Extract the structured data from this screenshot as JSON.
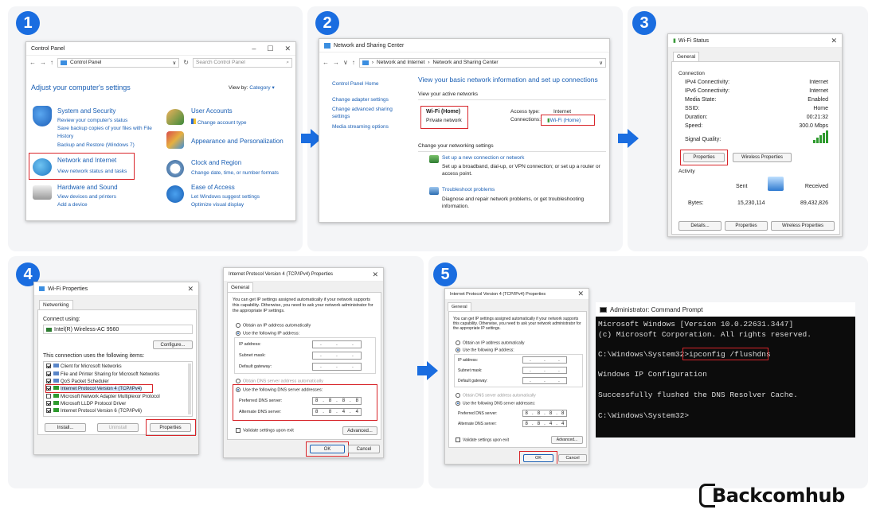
{
  "steps": [
    "1",
    "2",
    "3",
    "4",
    "5"
  ],
  "brand": "Backcomhub",
  "cp": {
    "title": "Control Panel",
    "address": "Control Panel",
    "search_placeholder": "Search Control Panel",
    "heading": "Adjust your computer's settings",
    "view_by_label": "View by:",
    "view_by_value": "Category",
    "categories": [
      {
        "title": "System and Security",
        "links": [
          "Review your computer's status",
          "Save backup copies of your files with File",
          "History",
          "Backup and Restore (Windows 7)"
        ]
      },
      {
        "title": "Network and Internet",
        "links": [
          "View network status and tasks"
        ]
      },
      {
        "title": "Hardware and Sound",
        "links": [
          "View devices and printers",
          "Add a device"
        ]
      },
      {
        "title": "User Accounts",
        "links": [
          "Change account type"
        ]
      },
      {
        "title": "Appearance and Personalization",
        "links": []
      },
      {
        "title": "Clock and Region",
        "links": [
          "Change date, time, or number formats"
        ]
      },
      {
        "title": "Ease of Access",
        "links": [
          "Let Windows suggest settings",
          "Optimize visual display"
        ]
      }
    ]
  },
  "nsc": {
    "title": "Network and Sharing Center",
    "crumb1": "Network and Internet",
    "crumb2": "Network and Sharing Center",
    "side": [
      "Control Panel Home",
      "Change adapter settings",
      "Change advanced sharing settings",
      "Media streaming options"
    ],
    "heading": "View your basic network information and set up connections",
    "active_label": "View your active networks",
    "net_name": "Wi-Fi (Home)",
    "net_type": "Private network",
    "access_type_label": "Access type:",
    "access_type_value": "Internet",
    "connections_label": "Connections:",
    "connections_value": "Wi-Fi (Home)",
    "change_label": "Change your networking settings",
    "setup_title": "Set up a new connection or network",
    "setup_desc": "Set up a broadband, dial-up, or VPN connection; or set up a router or access point.",
    "trouble_title": "Troubleshoot problems",
    "trouble_desc": "Diagnose and repair network problems, or get troubleshooting information."
  },
  "wifi_status": {
    "title": "Wi-Fi Status",
    "tab": "General",
    "connection_label": "Connection",
    "rows": [
      {
        "k": "IPv4 Connectivity:",
        "v": "Internet"
      },
      {
        "k": "IPv6 Connectivity:",
        "v": "Internet"
      },
      {
        "k": "Media State:",
        "v": "Enabled"
      },
      {
        "k": "SSID:",
        "v": "Home"
      },
      {
        "k": "Duration:",
        "v": "00:21:32"
      },
      {
        "k": "Speed:",
        "v": "300.0 Mbps"
      }
    ],
    "signal_label": "Signal Quality:",
    "properties_btn": "Properties",
    "wireless_props_btn": "Wireless Properties",
    "activity_label": "Activity",
    "sent_label": "Sent",
    "received_label": "Received",
    "bytes_label": "Bytes:",
    "bytes_sent": "15,230,114",
    "bytes_received": "89,432,826",
    "details_btn": "Details...",
    "bottom_props_btn": "Properties",
    "bottom_wireless_btn": "Wireless Properties"
  },
  "wifi_props": {
    "title": "Wi-Fi Properties",
    "tab": "Networking",
    "connect_using": "Connect using:",
    "adapter": "Intel(R) Wireless-AC 9560",
    "configure_btn": "Configure...",
    "uses_label": "This connection uses the following items:",
    "items": [
      "Client for Microsoft Networks",
      "File and Printer Sharing for Microsoft Networks",
      "QoS Packet Scheduler",
      "Internet Protocol Version 4 (TCP/IPv4)",
      "Microsoft Network Adapter Multiplexor Protocol",
      "Microsoft LLDP Protocol Driver",
      "Internet Protocol Version 6 (TCP/IPv6)"
    ],
    "install_btn": "Install...",
    "uninstall_btn": "Uninstall",
    "properties_btn": "Properties"
  },
  "ipv4": {
    "title": "Internet Protocol Version 4 (TCP/IPv4) Properties",
    "tab": "General",
    "intro": "You can get IP settings assigned automatically if your network supports this capability. Otherwise, you need to ask your network administrator for the appropriate IP settings.",
    "auto_ip": "Obtain an IP address automatically",
    "use_ip": "Use the following IP address:",
    "ip_label": "IP address:",
    "subnet_label": "Subnet mask:",
    "gateway_label": "Default gateway:",
    "auto_dns": "Obtain DNS server address automatically",
    "use_dns": "Use the following DNS server addresses:",
    "pref_label": "Preferred DNS server:",
    "alt_label": "Alternate DNS server:",
    "pref_dns": [
      "8",
      "8",
      "8",
      "8"
    ],
    "alt_dns": [
      "8",
      "8",
      "4",
      "4"
    ],
    "validate": "Validate settings upon exit",
    "advanced_btn": "Advanced...",
    "ok_btn": "OK",
    "cancel_btn": "Cancel"
  },
  "cmd": {
    "title": "Administrator: Command Prompt",
    "line1": "Microsoft Windows [Version 10.0.22631.3447]",
    "line2": "(c) Microsoft Corporation. All rights reserved.",
    "prompt": "C:\\Windows\\System32>",
    "command": "ipconfig /flushdns",
    "out1": "Windows IP Configuration",
    "out2": "Successfully flushed the DNS Resolver Cache.",
    "prompt2": "C:\\Windows\\System32>"
  },
  "colors": {
    "accent": "#1a6de0",
    "highlight": "#d8252a",
    "link": "#1a5fb4"
  }
}
